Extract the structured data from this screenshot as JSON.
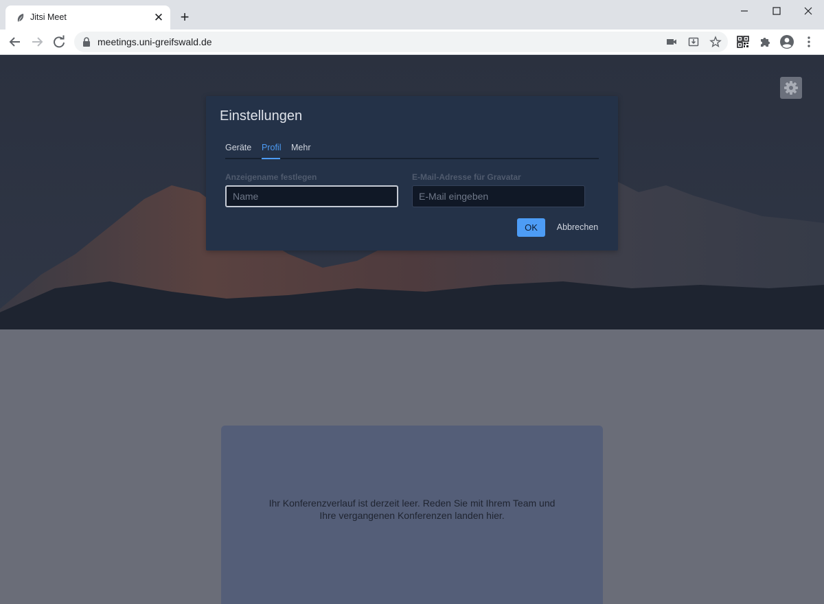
{
  "browser": {
    "tab": {
      "title": "Jitsi Meet",
      "favicon": "jitsi-feather-icon",
      "close_icon": "close-icon"
    },
    "new_tab_icon": "plus-icon",
    "window_controls": [
      "minimize-icon",
      "maximize-icon",
      "close-icon"
    ],
    "address_bar": {
      "url": "meetings.uni-greifswald.de",
      "lock_icon": "lock-icon"
    },
    "omnibox_icons": [
      "camera-icon",
      "install-icon",
      "star-icon"
    ],
    "toolbar_icons": [
      "qr-code-icon",
      "extensions-icon",
      "profile-icon",
      "menu-icon"
    ]
  },
  "page": {
    "settings_icon": "gear-icon",
    "history": {
      "line1": "Ihr Konferenzverlauf ist derzeit leer. Reden Sie mit Ihrem Team und",
      "line2": "Ihre vergangenen Konferenzen landen hier."
    }
  },
  "dialog": {
    "title": "Einstellungen",
    "tabs": [
      {
        "label": "Geräte",
        "active": false
      },
      {
        "label": "Profil",
        "active": true
      },
      {
        "label": "Mehr",
        "active": false
      }
    ],
    "fields": {
      "name": {
        "label": "Anzeigename festlegen",
        "placeholder": "Name",
        "value": ""
      },
      "email": {
        "label": "E-Mail-Adresse für Gravatar",
        "placeholder": "E-Mail eingeben",
        "value": ""
      }
    },
    "ok_label": "OK",
    "cancel_label": "Abbrechen"
  },
  "colors": {
    "accent": "#4d9cf5",
    "dialog_bg": "#243248",
    "hero_bg": "#2a3140",
    "history_card_bg": "#545e78"
  }
}
